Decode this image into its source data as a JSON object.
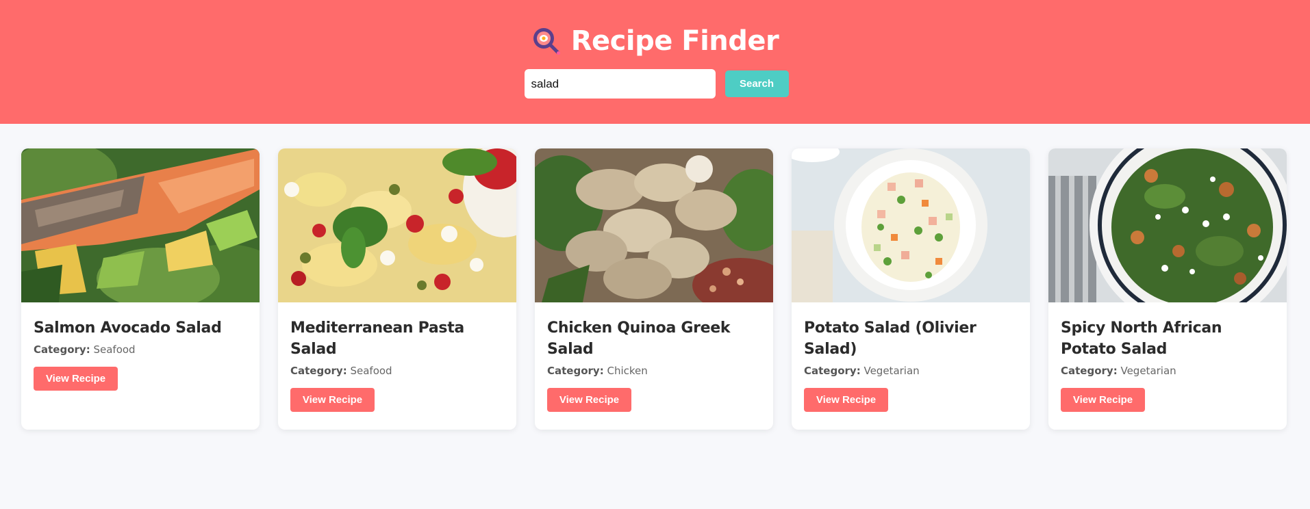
{
  "header": {
    "title": "Recipe Finder",
    "icon": "magnifier-frying-pan-icon",
    "background_color": "#ff6b6b"
  },
  "search": {
    "value": "salad",
    "button_label": "Search",
    "button_color": "#4ecdc4"
  },
  "recipes": [
    {
      "title": "Salmon Avocado Salad",
      "category_label": "Category:",
      "category": "Seafood",
      "button_label": "View Recipe",
      "image": "salmon-avocado-salad-photo"
    },
    {
      "title": "Mediterranean Pasta Salad",
      "category_label": "Category:",
      "category": "Seafood",
      "button_label": "View Recipe",
      "image": "mediterranean-pasta-salad-photo"
    },
    {
      "title": "Chicken Quinoa Greek Salad",
      "category_label": "Category:",
      "category": "Chicken",
      "button_label": "View Recipe",
      "image": "chicken-quinoa-greek-salad-photo"
    },
    {
      "title": "Potato Salad (Olivier Salad)",
      "category_label": "Category:",
      "category": "Vegetarian",
      "button_label": "View Recipe",
      "image": "potato-olivier-salad-photo"
    },
    {
      "title": "Spicy North African Potato Salad",
      "category_label": "Category:",
      "category": "Vegetarian",
      "button_label": "View Recipe",
      "image": "spicy-north-african-potato-salad-photo"
    }
  ],
  "accent_color": "#ff6b6b"
}
